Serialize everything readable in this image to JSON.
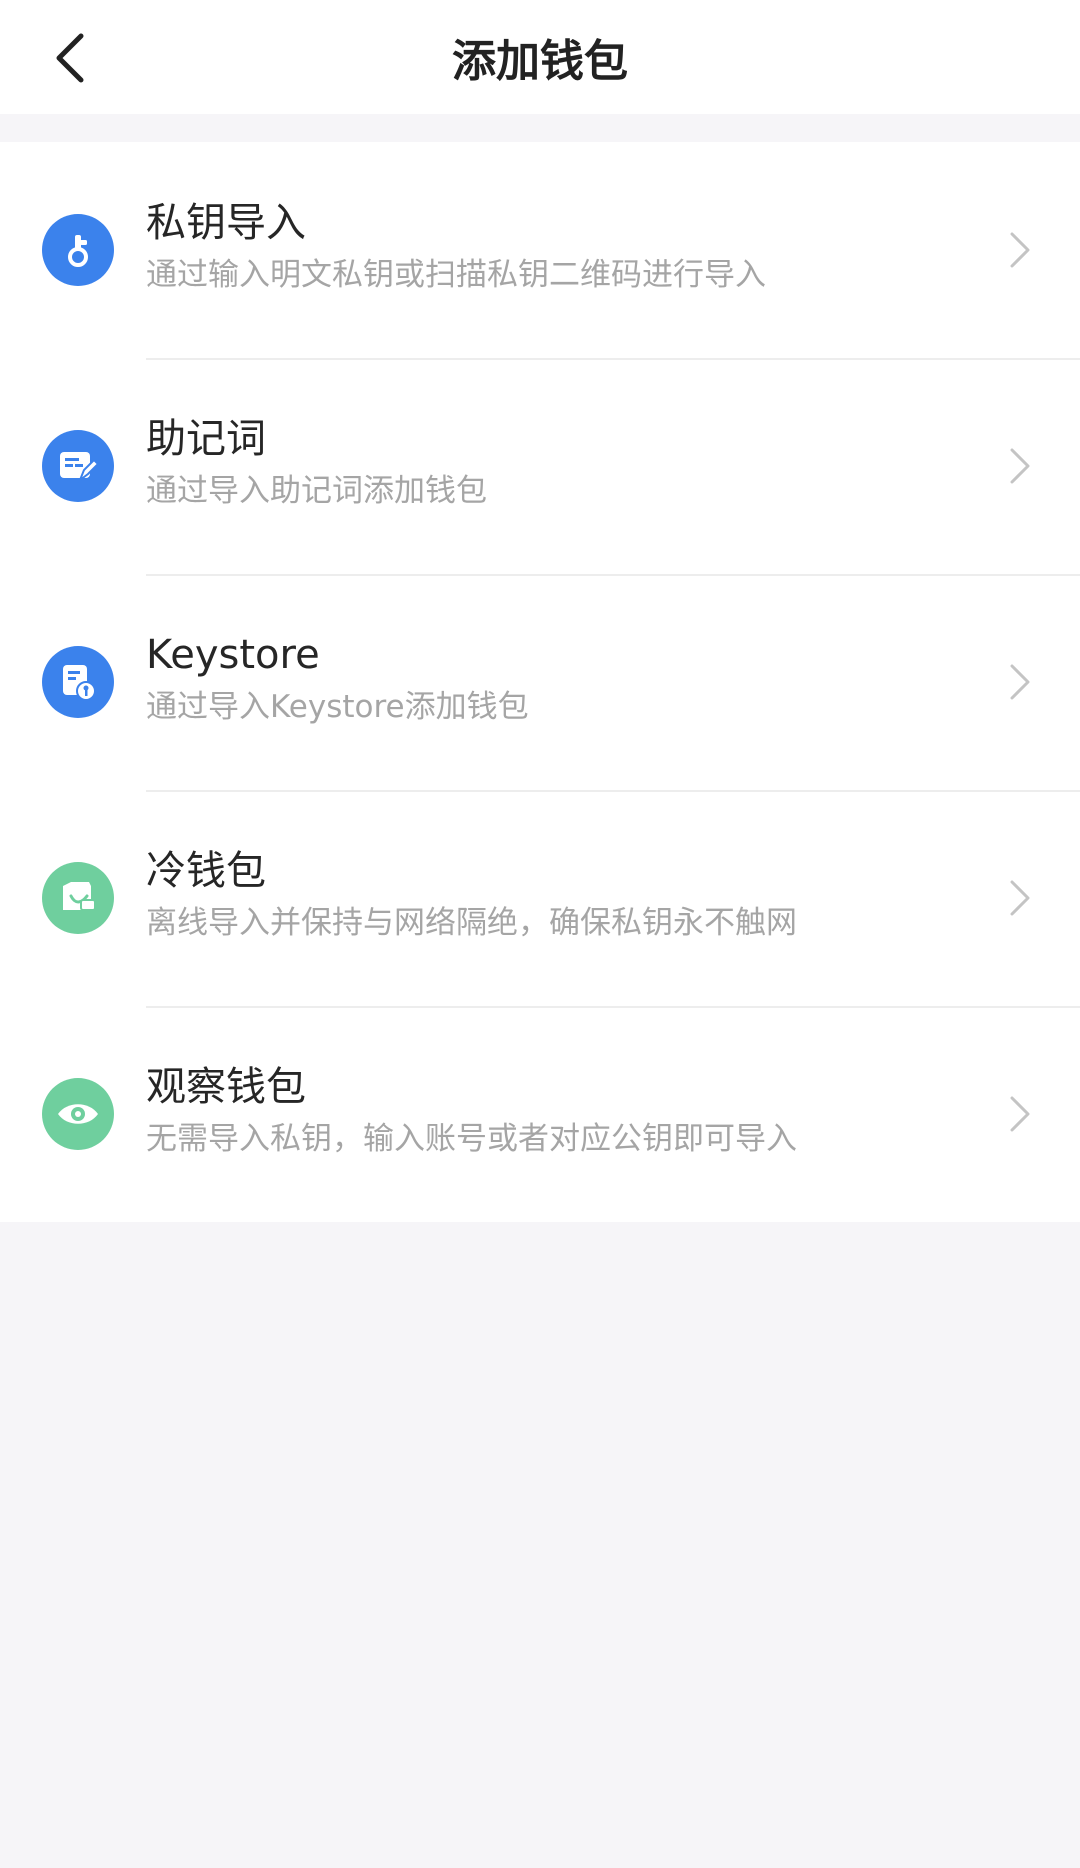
{
  "header": {
    "title": "添加钱包"
  },
  "colors": {
    "blue": "#3b82ec",
    "green": "#6fcf9e"
  },
  "items": [
    {
      "title": "私钥导入",
      "desc": "通过输入明文私钥或扫描私钥二维码进行导入",
      "icon": "key-icon"
    },
    {
      "title": "助记词",
      "desc": "通过导入助记词添加钱包",
      "icon": "mnemonic-icon"
    },
    {
      "title": "Keystore",
      "desc": "通过导入Keystore添加钱包",
      "icon": "keystore-icon"
    },
    {
      "title": "冷钱包",
      "desc": "离线导入并保持与网络隔绝，确保私钥永不触网",
      "icon": "cold-wallet-icon"
    },
    {
      "title": "观察钱包",
      "desc": "无需导入私钥，输入账号或者对应公钥即可导入",
      "icon": "eye-icon"
    }
  ]
}
